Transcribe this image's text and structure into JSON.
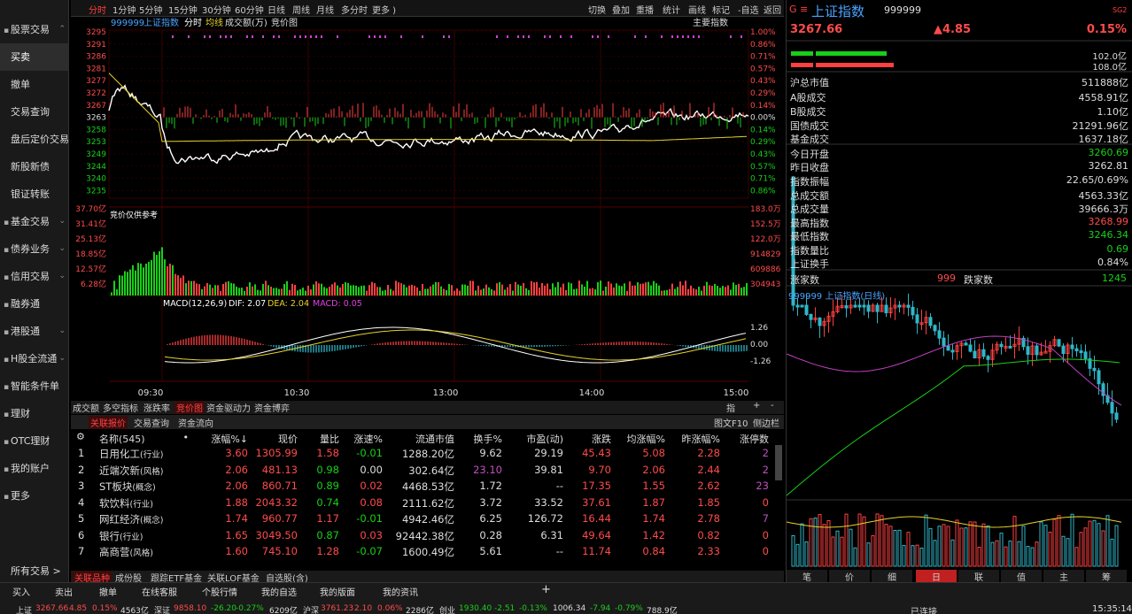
{
  "sidebar": {
    "items": [
      {
        "label": "股票交易",
        "icon": "bag-icon",
        "chev": "⌃"
      },
      {
        "label": "买卖",
        "sel": true
      },
      {
        "label": "撤单"
      },
      {
        "label": "交易查询"
      },
      {
        "label": "盘后定价交易"
      },
      {
        "label": "新股新债"
      },
      {
        "label": "银证转账"
      },
      {
        "label": "基金交易",
        "icon": "fund-icon",
        "chev": "⌄"
      },
      {
        "label": "债券业务",
        "icon": "bond-icon",
        "chev": "⌄"
      },
      {
        "label": "信用交易",
        "icon": "credit-icon",
        "chev": "⌄"
      },
      {
        "label": "融券通",
        "icon": "loan-icon"
      },
      {
        "label": "港股通",
        "icon": "hk-icon",
        "chev": "⌄"
      },
      {
        "label": "H股全流通",
        "icon": "h-icon",
        "chev": "⌄"
      },
      {
        "label": "智能条件单",
        "icon": "condition-icon"
      },
      {
        "label": "理财",
        "icon": "finance-icon"
      },
      {
        "label": "OTC理财",
        "icon": "otc-icon"
      },
      {
        "label": "我的账户",
        "icon": "account-icon"
      },
      {
        "label": "更多",
        "icon": "more-icon"
      }
    ],
    "all": "所有交易 >"
  },
  "topmenu": {
    "left": [
      "分时",
      "1分钟",
      "5分钟",
      "15分钟",
      "30分钟",
      "60分钟",
      "日线",
      "周线",
      "月线",
      "多分时",
      "更多 )"
    ],
    "right": [
      "切换",
      "叠加",
      "重播",
      "统计",
      "画线",
      "标记",
      "-自选",
      "返回"
    ]
  },
  "chart": {
    "code": "999999",
    "name": "上证指数",
    "legend": [
      "分时",
      "均线",
      "成交额(万)",
      "竞价图"
    ],
    "main_ind": "主要指数",
    "price_labels": [
      "3295",
      "3291",
      "3286",
      "3281",
      "3277",
      "3272",
      "3267",
      "3263",
      "3258",
      "3253",
      "3249",
      "3244",
      "3240",
      "3235"
    ],
    "pct_labels": [
      "1.00%",
      "0.86%",
      "0.71%",
      "0.57%",
      "0.43%",
      "0.29%",
      "0.14%",
      "0.00%",
      "0.14%",
      "0.29%",
      "0.43%",
      "0.57%",
      "0.71%",
      "0.86%"
    ],
    "vol_left": [
      "37.70亿",
      "31.41亿",
      "25.13亿",
      "18.85亿",
      "12.57亿",
      "6.28亿"
    ],
    "vol_right": [
      "183.0万",
      "152.5万",
      "122.0万",
      "914829",
      "609886",
      "304943"
    ],
    "auction_note": "竞价仅供参考",
    "macd_title": "MACD(12,26,9)",
    "dif": "DIF: 2.07",
    "dea": "DEA: 2.04",
    "macd": "MACD: 0.05",
    "macd_labels": [
      "1.26",
      "0.00",
      "-1.26"
    ],
    "times": [
      "09:30",
      "10:30",
      "13:00",
      "14:00",
      "15:00"
    ]
  },
  "tabs1": {
    "items": [
      "成交额",
      "多空指标",
      "涨跌率",
      "竞价图",
      "资金驱动力",
      "资金博弈"
    ],
    "sel": 3,
    "right": [
      "指",
      "+",
      "-"
    ]
  },
  "tabs2": {
    "items": [
      "关联报价",
      "交易查询",
      "资金流向"
    ],
    "sel": 0,
    "right": [
      "图文F10",
      "侧边栏"
    ]
  },
  "table": {
    "headers": [
      "名称(545)",
      "•",
      "涨幅%↓",
      "现价",
      "量比",
      "涨速%",
      "流通市值",
      "换手%",
      "市盈(动)",
      "涨跌",
      "均涨幅%",
      "昨涨幅%",
      "涨停数"
    ],
    "rows": [
      [
        "1",
        "日用化工",
        "(行业)",
        "3.60",
        "1305.99",
        "1.58",
        "-0.01",
        "1288.20亿",
        "9.62",
        "29.19",
        "45.43",
        "5.08",
        "2.28",
        "2"
      ],
      [
        "2",
        "近端次新",
        "(风格)",
        "2.06",
        "481.13",
        "0.98",
        "0.00",
        "302.64亿",
        "23.10",
        "39.81",
        "9.70",
        "2.06",
        "2.44",
        "2"
      ],
      [
        "3",
        "ST板块",
        "(概念)",
        "2.06",
        "860.71",
        "0.89",
        "0.02",
        "4468.53亿",
        "1.72",
        "--",
        "17.35",
        "1.55",
        "2.62",
        "23"
      ],
      [
        "4",
        "软饮料",
        "(行业)",
        "1.88",
        "2043.32",
        "0.74",
        "0.08",
        "2111.62亿",
        "3.72",
        "33.52",
        "37.61",
        "1.87",
        "1.85",
        "0"
      ],
      [
        "5",
        "网红经济",
        "(概念)",
        "1.74",
        "960.77",
        "1.17",
        "-0.01",
        "4942.46亿",
        "6.25",
        "126.72",
        "16.44",
        "1.74",
        "2.78",
        "7"
      ],
      [
        "6",
        "银行",
        "(行业)",
        "1.65",
        "3049.50",
        "0.87",
        "0.03",
        "92442.38亿",
        "0.28",
        "6.31",
        "49.64",
        "1.42",
        "0.82",
        "0"
      ],
      [
        "7",
        "高商营",
        "(风格)",
        "1.60",
        "745.10",
        "1.28",
        "-0.07",
        "1600.49亿",
        "5.61",
        "--",
        "11.74",
        "0.84",
        "2.33",
        "0"
      ]
    ]
  },
  "tabs3": {
    "items": [
      "关联品种",
      "成份股",
      "跟踪ETF基金",
      "关联LOF基金",
      "自选股(含)"
    ],
    "sel": 0
  },
  "rpanel": {
    "title": "上证指数",
    "code": "999999",
    "badge": "SG2",
    "price": "3267.66",
    "chg": "▲4.85",
    "pct": "0.15%",
    "bar1": "102.0亿",
    "bar2": "108.0亿",
    "rows": [
      [
        "沪总市值",
        "511888亿",
        "white"
      ],
      [
        "A股成交",
        "4558.91亿",
        "white"
      ],
      [
        "B股成交",
        "1.10亿",
        "white"
      ],
      [
        "国债成交",
        "21291.96亿",
        "white"
      ],
      [
        "基金成交",
        "1637.18亿",
        "white"
      ],
      [
        "今日开盘",
        "3260.69",
        "green"
      ],
      [
        "昨日收盘",
        "3262.81",
        "white"
      ],
      [
        "指数振幅",
        "22.65/0.69%",
        "white"
      ],
      [
        "总成交额",
        "4563.33亿",
        "white"
      ],
      [
        "总成交量",
        "39666.3万",
        "white"
      ],
      [
        "最高指数",
        "3268.99",
        "red"
      ],
      [
        "最低指数",
        "3246.34",
        "green"
      ],
      [
        "指数量比",
        "0.69",
        "green"
      ],
      [
        "上证换手",
        "0.84%",
        "white"
      ]
    ],
    "up_label": "涨家数",
    "up": "999",
    "down_label": "跌家数",
    "down": "1245",
    "kline_title": "999999 上证指数(日线)",
    "bottom_tabs": [
      "笔",
      "价",
      "细",
      "日",
      "联",
      "值",
      "主",
      "筹"
    ],
    "bottom_sel": 3
  },
  "bottombar": {
    "actions": [
      "买入",
      "卖出",
      "撤单",
      "在线客服",
      "个股行情",
      "我的自选",
      "我的版面",
      "我的资讯"
    ],
    "ticker": [
      [
        "上证",
        "white"
      ],
      [
        "3267.66",
        "red"
      ],
      [
        "4.85",
        "red"
      ],
      [
        "0.15%",
        "red"
      ],
      [
        "4563亿",
        "white"
      ],
      [
        "深证",
        "white"
      ],
      [
        "9858.10",
        "red"
      ],
      [
        "-26.20",
        "green"
      ],
      [
        "-0.27%",
        "green"
      ],
      [
        "6209亿",
        "white"
      ],
      [
        "沪深",
        "white"
      ],
      [
        "3761.23",
        "red"
      ],
      [
        "2.10",
        "red"
      ],
      [
        "0.06%",
        "red"
      ],
      [
        "2286亿",
        "white"
      ],
      [
        "创业",
        "white"
      ],
      [
        "1930.40",
        "green"
      ],
      [
        "-2.51",
        "green"
      ],
      [
        "-0.13%",
        "green"
      ],
      [
        "1006.34",
        "white"
      ],
      [
        "-7.94",
        "green"
      ],
      [
        "-0.79%",
        "green"
      ],
      [
        "788.9亿",
        "white"
      ]
    ],
    "status": "已连接",
    "time": "15:35:14"
  }
}
